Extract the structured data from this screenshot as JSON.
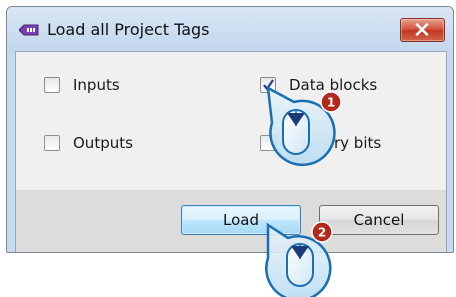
{
  "window": {
    "title": "Load all Project Tags",
    "close_glyph": "✕"
  },
  "options": [
    {
      "label": "Inputs",
      "checked": false
    },
    {
      "label": "Data blocks",
      "checked": true
    },
    {
      "label": "Outputs",
      "checked": false
    },
    {
      "label": "ry bits",
      "checked": false
    }
  ],
  "buttons": {
    "load": "Load",
    "cancel": "Cancel"
  },
  "annotations": [
    {
      "number": "1",
      "icon": "mouse-click-icon"
    },
    {
      "number": "2",
      "icon": "mouse-click-icon"
    }
  ],
  "colors": {
    "badge": "#b3271c",
    "mouse_ring": "#1a6fb0",
    "close_button": "#c7432d"
  }
}
